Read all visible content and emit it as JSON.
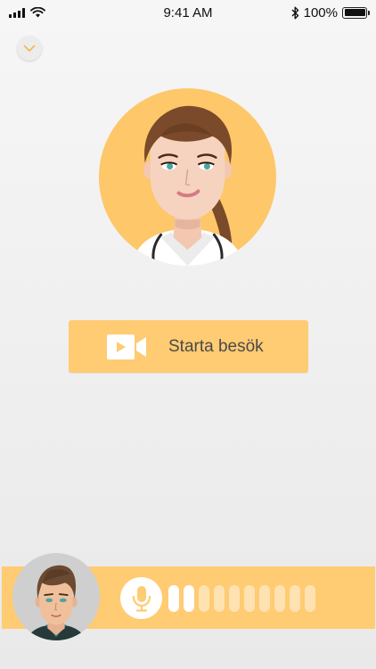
{
  "status_bar": {
    "time": "9:41 AM",
    "battery_text": "100%",
    "battery_level": 1.0,
    "icons": [
      "signal-icon",
      "wifi-icon",
      "bluetooth-icon",
      "battery-icon"
    ]
  },
  "header": {
    "collapse_icon": "chevron-down-icon"
  },
  "doctor": {
    "avatar": "doctor-avatar"
  },
  "start_visit": {
    "label": "Starta besök",
    "icon": "video-camera-icon"
  },
  "call_bar": {
    "patient_avatar": "patient-avatar",
    "mic_icon": "microphone-icon",
    "audio_level": {
      "active_bars": 2,
      "total_bars": 10
    }
  },
  "colors": {
    "accent": "#ffcb73",
    "doctor_bg": "#fdc76a",
    "chevron": "#f4b94e"
  }
}
